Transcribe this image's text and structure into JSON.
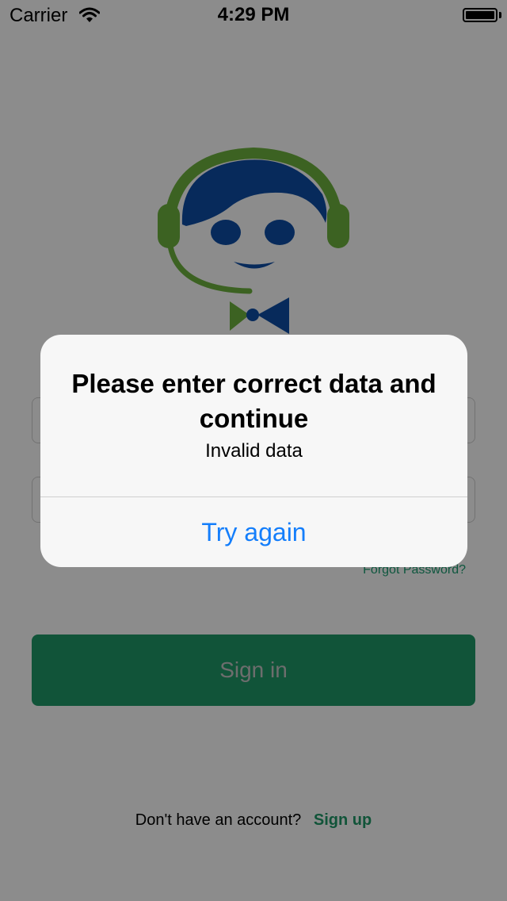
{
  "status_bar": {
    "carrier": "Carrier",
    "time": "4:29 PM"
  },
  "login_form": {
    "forgot_password": "Forgot Password?",
    "sign_in_label": "Sign in",
    "no_account_text": "Don't have an account?",
    "sign_up_label": "Sign up"
  },
  "alert": {
    "title": "Please enter correct data and continue",
    "message": "Invalid data",
    "button_label": "Try again"
  },
  "colors": {
    "brand_green": "#1f9a68",
    "logo_blue": "#0d4ea6",
    "logo_green": "#6db33f",
    "alert_button_blue": "#147efb"
  },
  "icons": {
    "wifi": "wifi-icon",
    "battery": "battery-icon",
    "logo": "support-agent-logo"
  }
}
